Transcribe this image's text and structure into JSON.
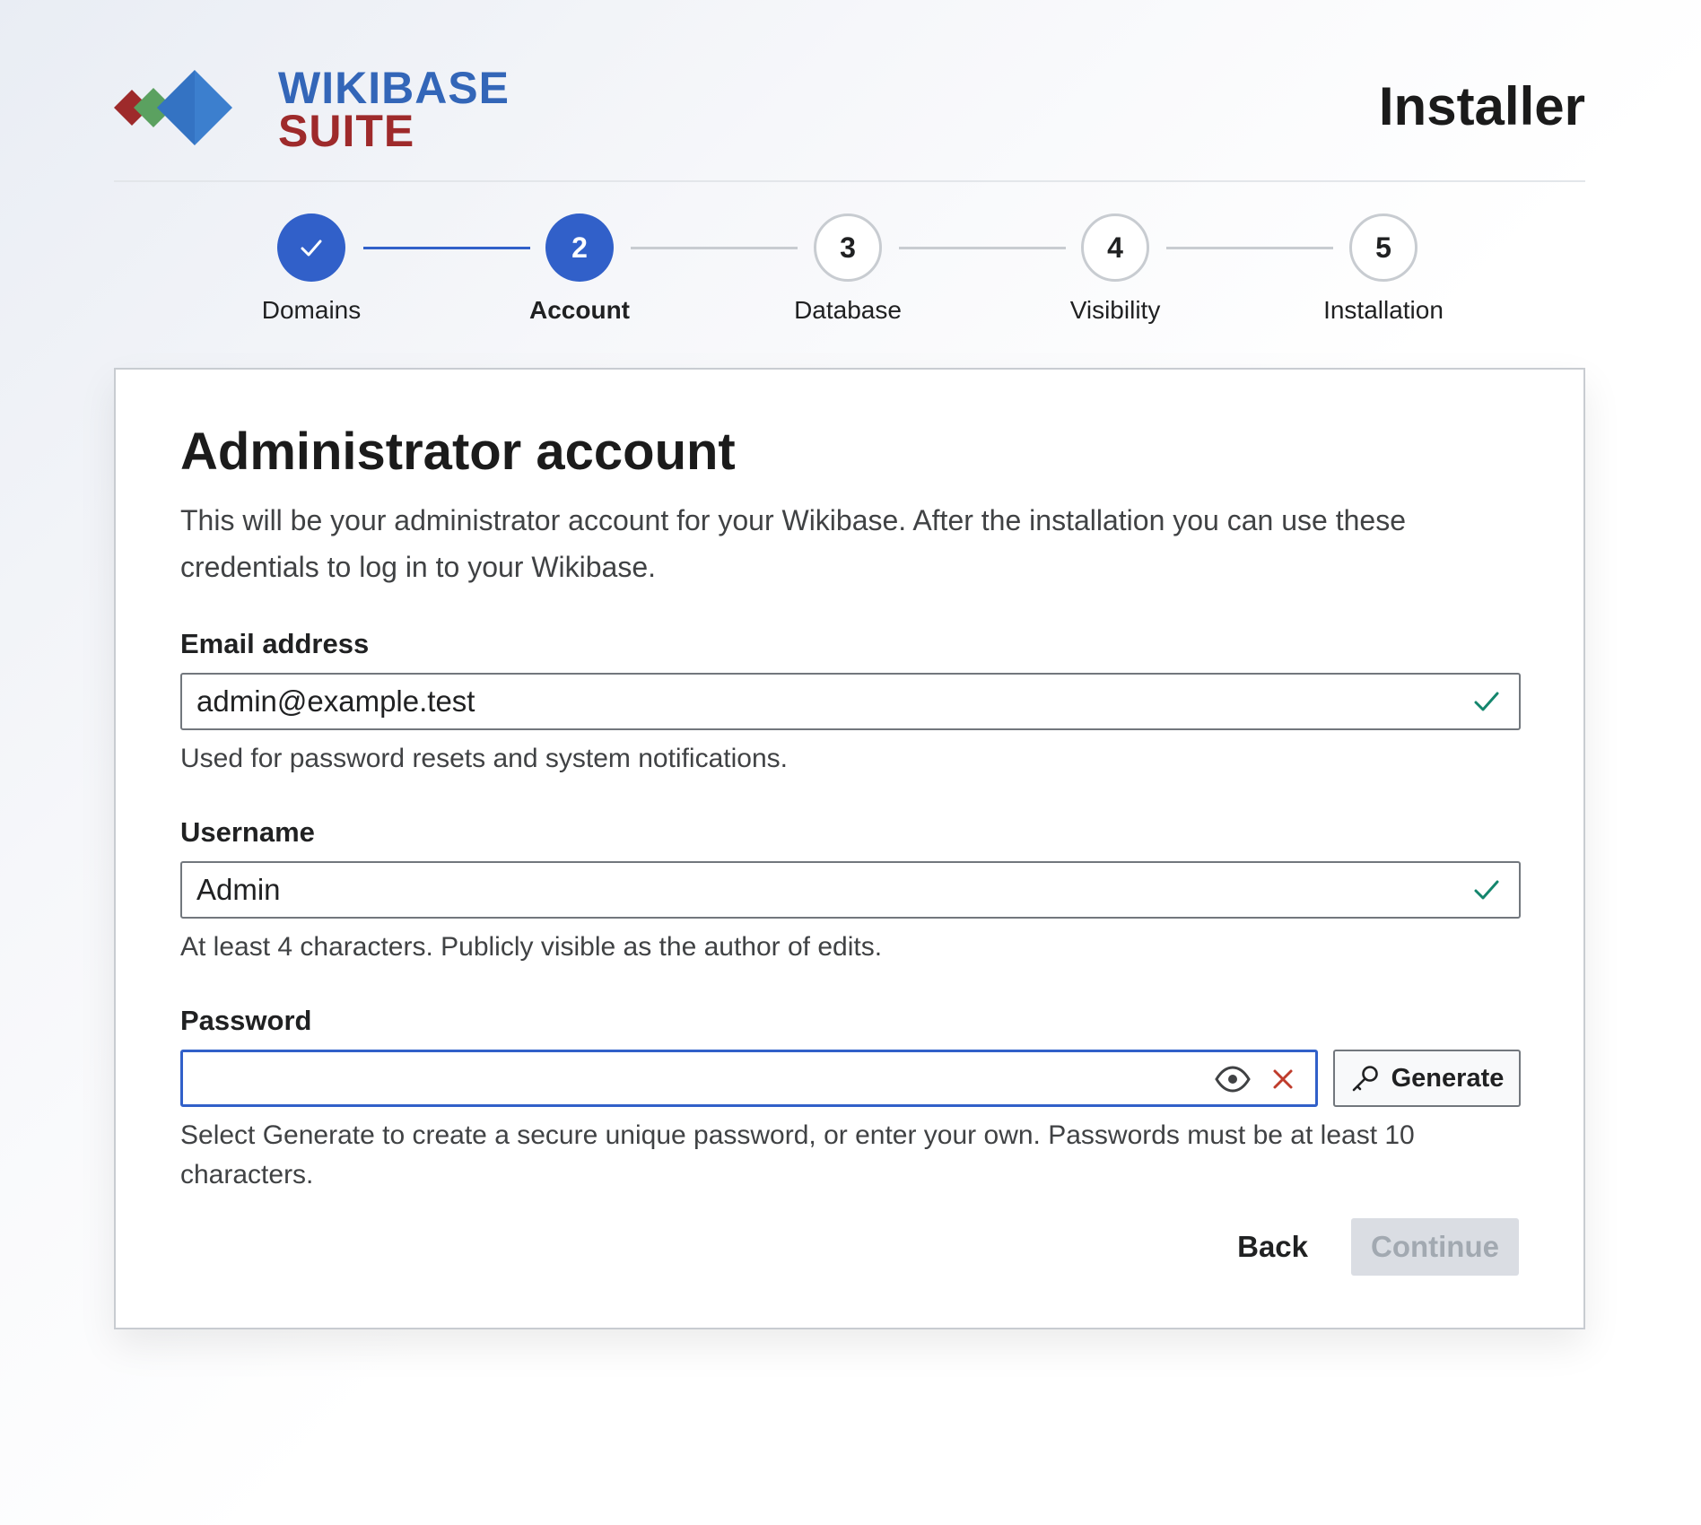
{
  "header": {
    "brand_line1": "WIKIBASE",
    "brand_line2": "SUITE",
    "title": "Installer"
  },
  "stepper": {
    "current_step": 2,
    "steps": [
      {
        "number": "✓",
        "label": "Domains",
        "state": "done"
      },
      {
        "number": "2",
        "label": "Account",
        "state": "active"
      },
      {
        "number": "3",
        "label": "Database",
        "state": "pending"
      },
      {
        "number": "4",
        "label": "Visibility",
        "state": "pending"
      },
      {
        "number": "5",
        "label": "Installation",
        "state": "pending"
      }
    ]
  },
  "form": {
    "title": "Administrator account",
    "intro": "This will be your administrator account for your Wikibase. After the installation you can use these credentials to log in to your Wikibase.",
    "email": {
      "label": "Email address",
      "value": "admin@example.test",
      "help": "Used for password resets and system notifications.",
      "valid": true
    },
    "username": {
      "label": "Username",
      "value": "Admin",
      "help": "At least 4 characters. Publicly visible as the author of edits.",
      "valid": true
    },
    "password": {
      "label": "Password",
      "value": "",
      "help": "Select Generate to create a secure unique password, or enter your own. Passwords must be at least 10 characters.",
      "generate_label": "Generate"
    },
    "back_label": "Back",
    "continue_label": "Continue"
  },
  "colors": {
    "primary": "#3160c9",
    "brand_blue": "#3366b8",
    "brand_red": "#9e2a2b",
    "valid_green": "#14866d",
    "clear_red": "#bf3c2c",
    "disabled_bg": "#dadde3"
  },
  "icons": {
    "logo": "wikibase-suite-logo",
    "step_done": "check-icon",
    "email_status": "check-icon",
    "username_status": "check-icon",
    "toggle_visibility": "eye-icon",
    "clear": "close-icon",
    "generate": "key-icon"
  }
}
